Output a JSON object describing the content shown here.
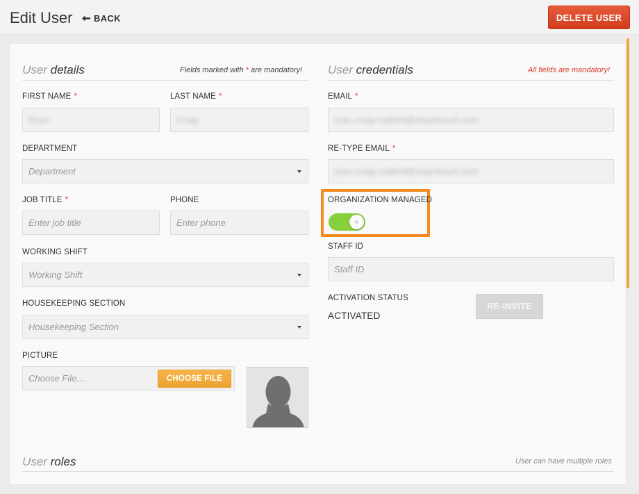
{
  "header": {
    "title": "Edit User",
    "back_label": "BACK",
    "delete_label": "DELETE USER"
  },
  "user_details": {
    "title_light": "User",
    "title_bold": "details",
    "note_prefix": "Fields marked with",
    "note_star": "*",
    "note_suffix": "are mandatory!",
    "first_name": {
      "label": "FIRST NAME",
      "value": "Ryan"
    },
    "last_name": {
      "label": "LAST NAME",
      "value": "Craig"
    },
    "department": {
      "label": "DEPARTMENT",
      "placeholder": "Department"
    },
    "job_title": {
      "label": "JOB TITLE",
      "placeholder": "Enter job title"
    },
    "phone": {
      "label": "PHONE",
      "placeholder": "Enter phone"
    },
    "working_shift": {
      "label": "WORKING SHIFT",
      "placeholder": "Working Shift"
    },
    "housekeeping_section": {
      "label": "HOUSEKEEPING SECTION",
      "placeholder": "Housekeeping Section"
    },
    "picture": {
      "label": "PICTURE",
      "placeholder": "Choose File....",
      "button_label": "CHOOSE FILE"
    },
    "required_mark": "*"
  },
  "user_credentials": {
    "title_light": "User",
    "title_bold": "credentials",
    "note": "All fields are mandatory!",
    "email": {
      "label": "EMAIL",
      "value": "ryan.craig+catbird@stayntouch.com"
    },
    "retype_email": {
      "label": "RE-TYPE EMAIL",
      "value": "ryan.craig+catbird@stayntouch.com"
    },
    "organization_managed": {
      "label": "ORGANIZATION MANAGED",
      "enabled": true
    },
    "staff_id": {
      "label": "STAFF ID",
      "placeholder": "Staff ID"
    },
    "activation_status": {
      "label": "ACTIVATION STATUS",
      "value": "ACTIVATED",
      "button_label": "RE-INVITE"
    }
  },
  "user_roles": {
    "title_light": "User",
    "title_bold": "roles",
    "note": "User can have multiple roles"
  },
  "colors": {
    "accent_orange": "#f58a1f",
    "delete_red": "#d9412b",
    "toggle_green": "#86cf3d",
    "choose_file_orange": "#f0a434"
  },
  "icons": {
    "back": "arrow-left-icon",
    "select": "caret-down-icon",
    "avatar": "person-silhouette-icon"
  }
}
